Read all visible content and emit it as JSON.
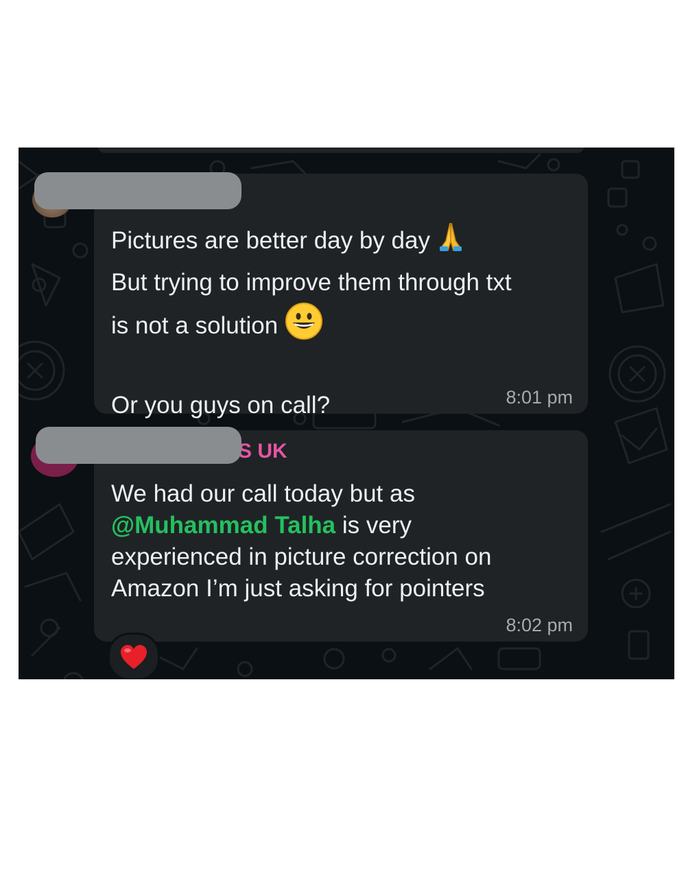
{
  "messages": [
    {
      "lines": [
        "Pictures are better day by day",
        "But trying to improve them through txt",
        "is not a solution",
        "",
        "Or you guys on call?"
      ],
      "inline_icons": [
        "folded-hands-emoji",
        "grinning-face-emoji"
      ],
      "time": "8:01 pm"
    },
    {
      "sender": "S UK",
      "text_part1": "We had our call today but as",
      "mention": "@Muhammad Talha",
      "text_part2": " is very",
      "line3": "experienced in picture correction on",
      "line4": "Amazon I’m just asking for pointers",
      "time": "8:02 pm",
      "reaction": "red-heart-emoji"
    }
  ],
  "colors": {
    "chat_background": "#0b1014",
    "bubble": "#1f2326",
    "sender_name": "#e754a4",
    "mention": "#25c05f",
    "timestamp": "#a5abaf"
  }
}
